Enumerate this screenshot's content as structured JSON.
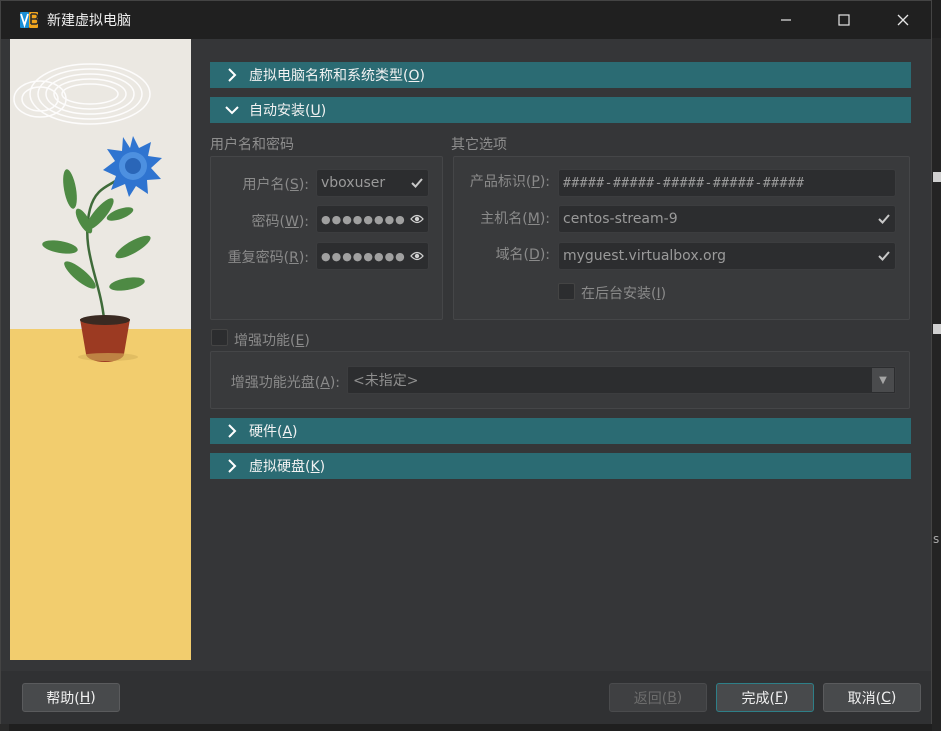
{
  "window": {
    "title": "新建虚拟电脑",
    "controls": {
      "minimize": "—",
      "maximize": "☐",
      "close": "✕"
    }
  },
  "sections": {
    "name_os": {
      "label": "虚拟电脑名称和系统类型(",
      "key": "O",
      "end": ")",
      "expanded": false
    },
    "unattended": {
      "label": "自动安装(",
      "key": "U",
      "end": ")",
      "expanded": true
    },
    "hardware": {
      "label": "硬件(",
      "key": "A",
      "end": ")",
      "expanded": false
    },
    "disk": {
      "label": "虚拟硬盘(",
      "key": "K",
      "end": ")",
      "expanded": false
    }
  },
  "credentials": {
    "group_title": "用户名和密码",
    "username": {
      "label": "用户名(",
      "key": "S",
      "end": "):",
      "value": "vboxuser"
    },
    "password": {
      "label": "密码(",
      "key": "W",
      "end": "):",
      "value": "●●●●●●●●"
    },
    "repeat_password": {
      "label": "重复密码(",
      "key": "R",
      "end": "):",
      "value": "●●●●●●●●"
    }
  },
  "other_options": {
    "group_title": "其它选项",
    "product_key": {
      "label": "产品标识(",
      "key": "P",
      "end": "):",
      "placeholder": "#####-#####-#####-#####-#####"
    },
    "hostname": {
      "label": "主机名(",
      "key": "M",
      "end": "):",
      "value": "centos-stream-9"
    },
    "domain": {
      "label": "域名(",
      "key": "D",
      "end": "):",
      "value": "myguest.virtualbox.org"
    },
    "background_install": {
      "label": "在后台安装(",
      "key": "I",
      "end": ")",
      "checked": false
    }
  },
  "guest_additions": {
    "label": "增强功能(",
    "key": "E",
    "end": ")",
    "checked": false,
    "iso_label": "增强功能光盘(",
    "iso_key": "A",
    "iso_end": "):",
    "iso_value": "<未指定>"
  },
  "buttons": {
    "help": {
      "label": "帮助(",
      "key": "H",
      "end": ")"
    },
    "back": {
      "label": "返回(",
      "key": "B",
      "end": ")",
      "enabled": false
    },
    "finish": {
      "label": "完成(",
      "key": "F",
      "end": ")"
    },
    "cancel": {
      "label": "取消(",
      "key": "C",
      "end": ")"
    }
  },
  "icons": {
    "valid": "checkmark-icon",
    "reveal": "eye-icon",
    "collapsed": "chevron-right-icon",
    "expanded": "chevron-down-icon"
  },
  "colors": {
    "section_header": "#2b6b73",
    "window_bg": "#353638",
    "titlebar": "#202020",
    "primary_border": "#2e7f88"
  },
  "background_fragments": {
    "left_a": "0",
    "left_b": "0",
    "right_a": "s"
  }
}
